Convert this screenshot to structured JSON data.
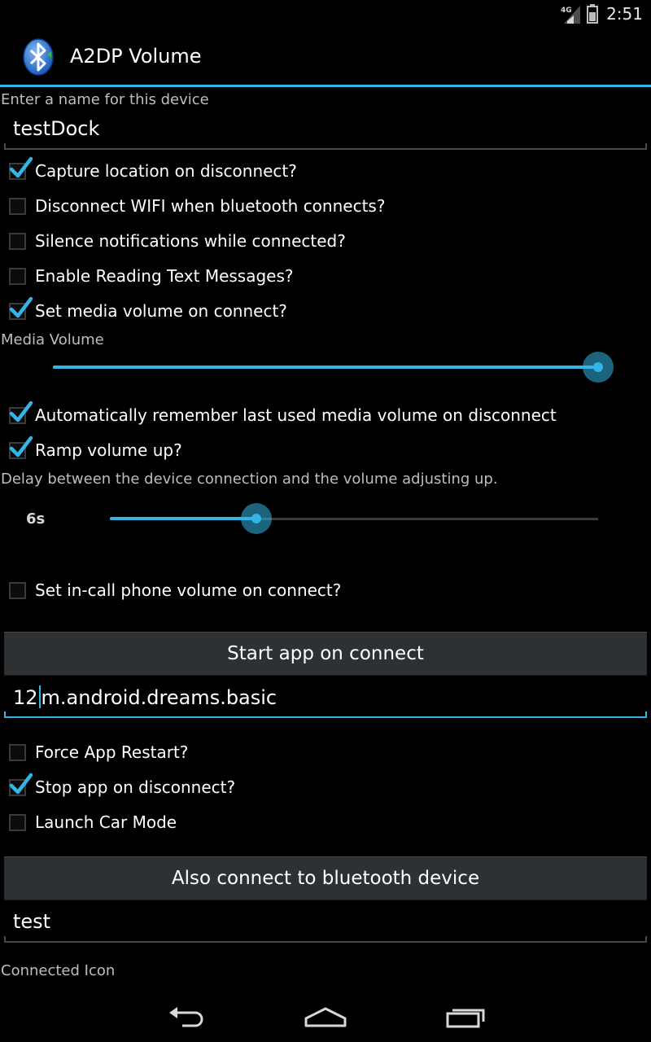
{
  "status_bar": {
    "time": "2:51",
    "network_label": "4G"
  },
  "app": {
    "title": "A2DP Volume",
    "icon": "bluetooth-icon"
  },
  "device_name": {
    "label": "Enter a name for this device",
    "value": "testDock"
  },
  "options": {
    "capture_location": {
      "label": "Capture location on disconnect?",
      "checked": true
    },
    "disconnect_wifi": {
      "label": "Disconnect WIFI when bluetooth connects?",
      "checked": false
    },
    "silence_notifications": {
      "label": "Silence notifications while connected?",
      "checked": false
    },
    "reading_text": {
      "label": "Enable Reading Text Messages?",
      "checked": false
    },
    "set_media_volume": {
      "label": "Set media volume on connect?",
      "checked": true
    },
    "remember_volume": {
      "label": "Automatically remember last used media volume on disconnect",
      "checked": true
    },
    "ramp_volume": {
      "label": "Ramp volume up?",
      "checked": true
    },
    "incall_volume": {
      "label": "Set in-call phone volume on connect?",
      "checked": false
    },
    "force_restart": {
      "label": "Force App Restart?",
      "checked": false
    },
    "stop_app": {
      "label": "Stop app on disconnect?",
      "checked": true
    },
    "car_mode": {
      "label": "Launch Car Mode",
      "checked": false
    }
  },
  "media_volume": {
    "label": "Media Volume",
    "level": 1.0
  },
  "ramp_delay": {
    "label": "Delay between the device connection and the volume adjusting up.",
    "value_text": "6s",
    "level": 0.3
  },
  "start_app": {
    "button_label": "Start app on connect",
    "value_before_cursor": "12",
    "value_after_cursor": "m.android.dreams.basic"
  },
  "bluetooth_device": {
    "button_label": "Also connect to bluetooth device",
    "value": "test"
  },
  "connected_icon": {
    "label": "Connected Icon"
  },
  "colors": {
    "accent": "#33b5e5",
    "button_bg": "#2e3134",
    "background": "#000000",
    "secondary_text": "#bdbdbd"
  },
  "nav_bar": {
    "back_icon": "back-icon",
    "home_icon": "home-icon",
    "recents_icon": "recents-icon"
  }
}
